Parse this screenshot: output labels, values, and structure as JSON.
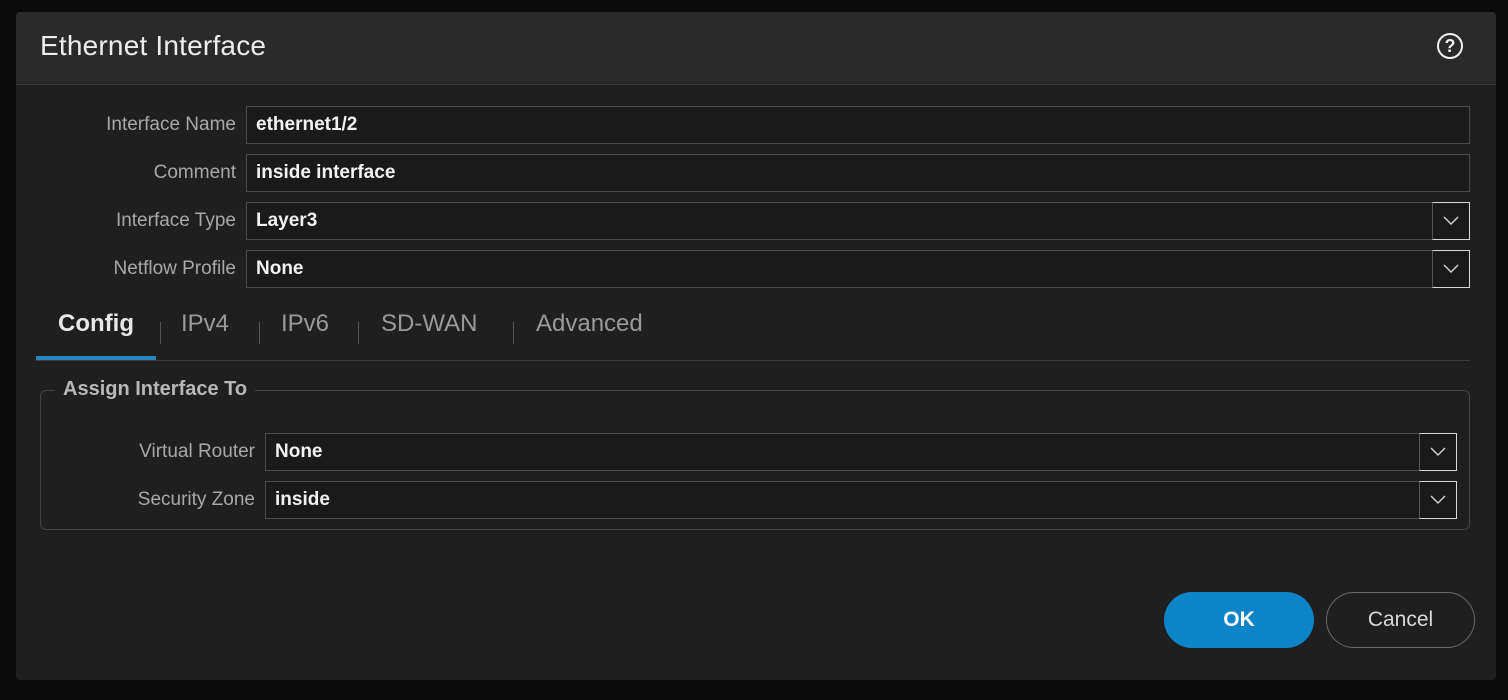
{
  "dialog": {
    "title": "Ethernet Interface",
    "help_icon": "question-circle-icon"
  },
  "form": {
    "interface_name": {
      "label": "Interface Name",
      "value": "ethernet1/2"
    },
    "comment": {
      "label": "Comment",
      "value": "inside interface"
    },
    "interface_type": {
      "label": "Interface Type",
      "value": "Layer3"
    },
    "netflow_profile": {
      "label": "Netflow Profile",
      "value": "None"
    }
  },
  "tabs": [
    {
      "label": "Config",
      "active": true
    },
    {
      "label": "IPv4",
      "active": false
    },
    {
      "label": "IPv6",
      "active": false
    },
    {
      "label": "SD-WAN",
      "active": false
    },
    {
      "label": "Advanced",
      "active": false
    }
  ],
  "assign": {
    "legend": "Assign Interface To",
    "virtual_router": {
      "label": "Virtual Router",
      "value": "None"
    },
    "security_zone": {
      "label": "Security Zone",
      "value": "inside"
    }
  },
  "buttons": {
    "ok": "OK",
    "cancel": "Cancel"
  },
  "colors": {
    "accent": "#0e84c8",
    "tab_underline": "#2a86c3",
    "dialog_bg": "#1f1f1f",
    "header_bg": "#2a2a2a"
  }
}
